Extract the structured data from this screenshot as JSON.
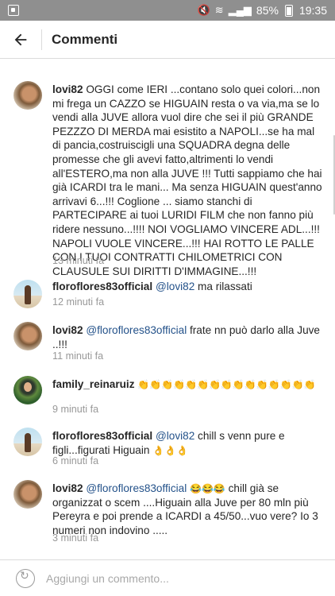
{
  "status_bar": {
    "battery": "85%",
    "time": "19:35",
    "icons": [
      "notification-icon",
      "mute-icon",
      "wifi-icon",
      "signal-icon",
      "battery-icon"
    ]
  },
  "header": {
    "title": "Commenti",
    "back_icon": "arrow-left-icon"
  },
  "comments": [
    {
      "username": "lovi82",
      "text": "OGGI come IERI ...contano solo quei colori...non mi frega un CAZZO se HIGUAIN resta o va via,ma se lo vendi alla JUVE allora vuol dire che sei il più GRANDE PEZZZO DI MERDA mai esistito a NAPOLI...se ha mal di pancia,costruiscigli una SQUADRA degna delle promesse che gli avevi fatto,altrimenti lo vendi all'ESTERO,ma non alla JUVE !!! Tutti sappiamo che hai già ICARDI tra le mani... Ma senza HIGUAIN quest'anno arrivavi 6...!!! Coglione ... siamo stanchi di  PARTECIPARE ai tuoi LURIDI FILM che non fanno più ridere nessuno...!!!! NOI VOGLIAMO VINCERE ADL...!!! NAPOLI VUOLE VINCERE...!!! HAI ROTTO LE PALLE CON I TUOI CONTRATTI CHILOMETRICI CON CLAUSULE SUI DIRITTI D'IMMAGINE...!!!",
      "time": "13 minuti fa"
    },
    {
      "username": "floroflores83official",
      "mention": "@lovi82",
      "text": "ma rilassati",
      "time": "12 minuti fa"
    },
    {
      "username": "lovi82",
      "mention": "@floroflores83official",
      "text": "frate nn può darlo alla Juve ..!!!",
      "time": "11 minuti fa"
    },
    {
      "username": "family_reinaruiz",
      "emoji": "👏👏👏👏👏👏👏👏👏👏👏👏👏👏👏",
      "time": "9 minuti fa"
    },
    {
      "username": "floroflores83official",
      "mention": "@lovi82",
      "text": "chill s venn pure e figli...figurati Higuain",
      "emoji": "👌👌👌",
      "time": "6 minuti fa"
    },
    {
      "username": "lovi82",
      "mention": "@floroflores83official",
      "emoji": "😂😂😂",
      "text": "chill già se organizzat o scem ....Higuain alla Juve per 80 mln più Pereyra e poi prende a ICARDI a 45/50...vuo vere? Io 3 numeri non indovino .....",
      "time": "3 minuti fa"
    }
  ],
  "composer": {
    "placeholder": "Aggiungi un commento...",
    "icon": "refresh-icon"
  }
}
